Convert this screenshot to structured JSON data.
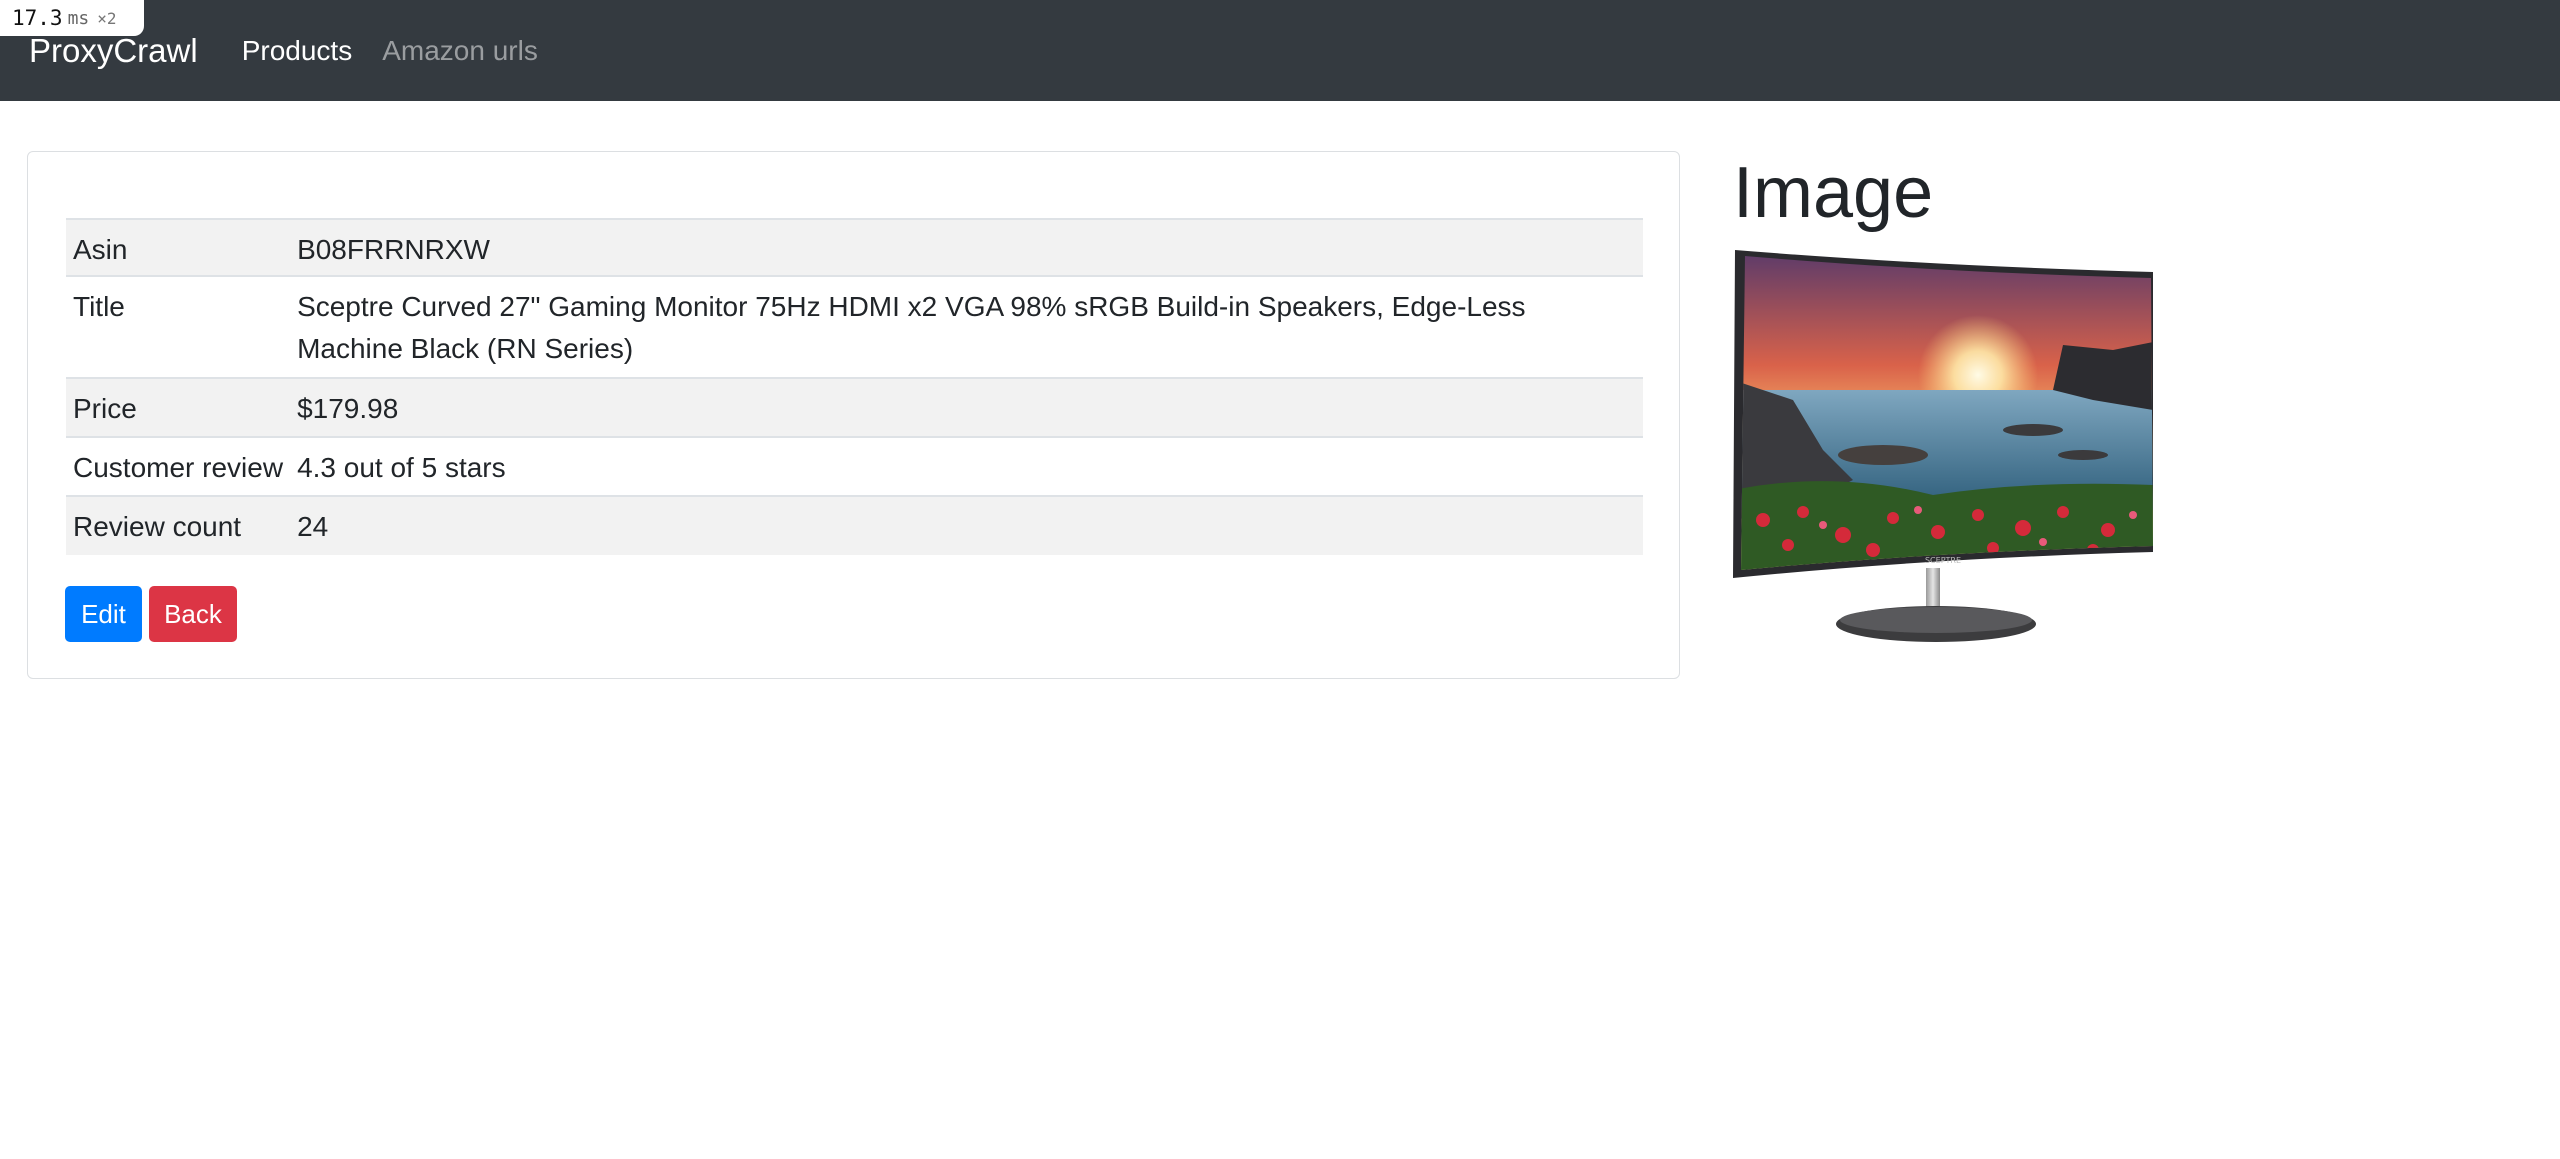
{
  "perf": {
    "value": "17.3",
    "unit": "ms",
    "multiplier": "×2"
  },
  "navbar": {
    "brand": "ProxyCrawl",
    "links": [
      {
        "label": "Products",
        "active": true
      },
      {
        "label": "Amazon urls",
        "active": false
      }
    ]
  },
  "details": {
    "rows": [
      {
        "label": "Asin",
        "value": "B08FRRNRXW"
      },
      {
        "label": "Title",
        "value": "Sceptre Curved 27\" Gaming Monitor 75Hz HDMI x2 VGA 98% sRGB Build-in Speakers, Edge-Less Machine Black (RN Series)"
      },
      {
        "label": "Price",
        "value": "$179.98"
      },
      {
        "label": "Customer review",
        "value": "4.3 out of 5 stars"
      },
      {
        "label": "Review count",
        "value": "24"
      }
    ]
  },
  "actions": {
    "edit_label": "Edit",
    "back_label": "Back"
  },
  "image_section": {
    "heading": "Image",
    "monitor_brand": "SCEPTRE"
  },
  "colors": {
    "navbar_bg": "#343a40",
    "edit_button": "#007bff",
    "back_button": "#dc3545",
    "row_stripe": "#f2f2f2"
  }
}
